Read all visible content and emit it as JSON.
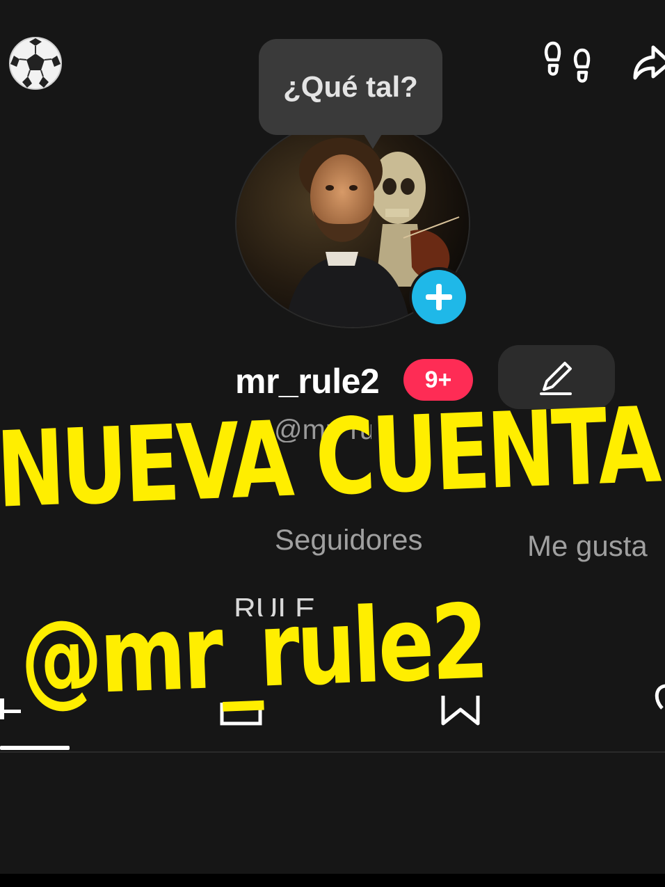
{
  "top_bar": {
    "left_icon": "soccer-ball-icon",
    "right_icons": [
      "footprints-icon",
      "share-icon"
    ]
  },
  "speech_bubble": {
    "text": "¿Qué tal?"
  },
  "profile": {
    "avatar": "painting-portrait-with-skeleton-violin",
    "username": "mr_rule2",
    "notification_badge": "9+",
    "handle": "@mr_rule2",
    "edit_icon": "pencil-icon",
    "add_icon": "plus-icon"
  },
  "stats": {
    "followers_label": "Seguidores",
    "likes_label": "Me gusta"
  },
  "bio": {
    "text": "RULE DE"
  },
  "tabs": {
    "icons": [
      "grid-icon",
      "repost-icon",
      "bookmark-icon",
      "liked-icon"
    ]
  },
  "overlay": {
    "line1": "NUEVA CUENTA",
    "line2": "@mr_rule2"
  },
  "colors": {
    "background": "#161616",
    "overlay_text": "#ffee00",
    "badge": "#fe2c55",
    "add_button": "#1fb8e8"
  }
}
